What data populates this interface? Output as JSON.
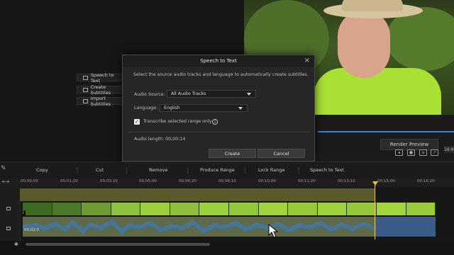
{
  "side_menu": {
    "items": [
      {
        "label": "Speech to Text",
        "icon": "speech-icon"
      },
      {
        "label": "Create Subtitles",
        "icon": "subtitle-icon"
      },
      {
        "label": "Import Subtitles",
        "icon": "import-icon"
      }
    ]
  },
  "dialog": {
    "title": "Speech to Text",
    "description": "Select the source audio tracks and language to automatically create subtitles.",
    "audio_source_label": "Audio Source:",
    "audio_source_value": "All Audio Tracks",
    "language_label": "Language:",
    "language_value": "English",
    "transcribe_label": "Transcribe selected range only",
    "transcribe_checked": true,
    "audio_length": "Audio length: 00;00;14",
    "create_label": "Create",
    "cancel_label": "Cancel"
  },
  "player": {
    "render_preview_label": "Render Preview",
    "timecode_fragment": "16:9"
  },
  "toolbar": {
    "items": [
      "Copy",
      "Cut",
      "Remove",
      "Produce Range",
      "Lock Range",
      "Speech to Text"
    ]
  },
  "timeline": {
    "ruler_labels": [
      "00;00;00",
      "00;01;20",
      "00;03;10",
      "00;05;00",
      "00;06;20",
      "00;08;10",
      "00;10;00",
      "00;11;20",
      "00;13;10",
      "00;15;00",
      "00;16;20"
    ],
    "audio_clip_label": "00;02;5"
  },
  "colors": {
    "playhead": "#e7c15a",
    "range_band": "#5b5a2a",
    "audio_selection": "#3a5c86",
    "progress": "#3b7fd4"
  }
}
